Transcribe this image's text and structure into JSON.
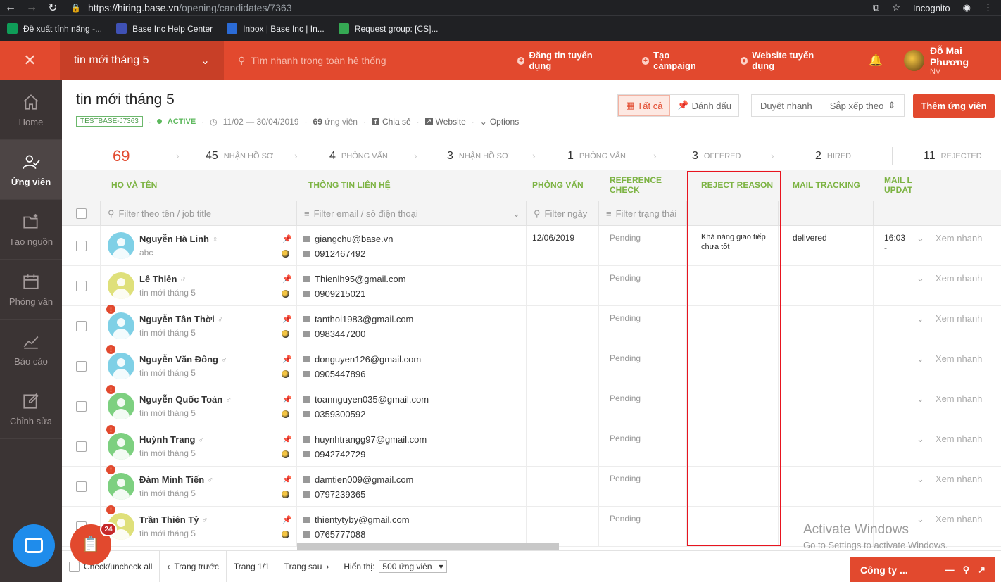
{
  "browser": {
    "url_base": "https://hiring.base.vn",
    "url_path": "/opening/candidates/7363",
    "incognito_label": "Incognito",
    "bookmarks": [
      {
        "label": "Đề xuất tính năng -...",
        "icon": "sheets-icon",
        "color": "#0f9d58"
      },
      {
        "label": "Base Inc Help Center",
        "icon": "shield-icon",
        "color": "#3f51b5"
      },
      {
        "label": "Inbox | Base Inc | In...",
        "icon": "intercom-icon",
        "color": "#2b6bd6"
      },
      {
        "label": "Request group: [CS]...",
        "icon": "circle-icon",
        "color": "#35a853"
      }
    ]
  },
  "header": {
    "opening_name": "tin mới tháng 5",
    "search_placeholder": "Tìm nhanh trong toàn hệ thống",
    "actions": [
      "Đăng tin tuyển dụng",
      "Tạo campaign",
      "Website tuyển dụng"
    ],
    "user_name": "Đỗ Mai Phương",
    "user_role": "NV",
    "accent_color": "#e2492e"
  },
  "sidebar": {
    "items": [
      {
        "label": "Home",
        "icon": "home-icon"
      },
      {
        "label": "Ứng viên",
        "icon": "candidates-icon",
        "active": true
      },
      {
        "label": "Tạo nguồn",
        "icon": "folder-add-icon"
      },
      {
        "label": "Phỏng vấn",
        "icon": "calendar-icon"
      },
      {
        "label": "Báo cáo",
        "icon": "chart-icon"
      },
      {
        "label": "Chỉnh sửa",
        "icon": "edit-icon"
      }
    ]
  },
  "page": {
    "title": "tin mới tháng 5",
    "code": "TESTBASE-J7363",
    "status": "ACTIVE",
    "date_range": "11/02 — 30/04/2019",
    "candidate_count": "69",
    "candidate_label": "ứng viên",
    "share": "Chia sẻ",
    "website": "Website",
    "options": "Options",
    "view_all": "Tất cả",
    "view_marked": "Đánh dấu",
    "quick_review": "Duyệt nhanh",
    "sort_by": "Sắp xếp theo",
    "add_candidate": "Thêm ứng viên"
  },
  "pipeline": [
    {
      "count": "69",
      "label": ""
    },
    {
      "count": "45",
      "label": "NHẬN HỒ SƠ"
    },
    {
      "count": "4",
      "label": "PHỎNG VẤN"
    },
    {
      "count": "3",
      "label": "NHẬN HỒ SƠ"
    },
    {
      "count": "1",
      "label": "PHỎNG VẤN"
    },
    {
      "count": "3",
      "label": "OFFERED"
    },
    {
      "count": "2",
      "label": "HIRED"
    },
    {
      "count": "11",
      "label": "REJECTED"
    }
  ],
  "table": {
    "headers": {
      "name": "HỌ VÀ TÊN",
      "contact": "THÔNG TIN LIÊN HỆ",
      "interview": "PHỎNG VẤN",
      "refcheck": "REFERENCE CHECK",
      "reject": "REJECT REASON",
      "mailtrack": "MAIL TRACKING",
      "mailupd": "MAIL L UPDAT"
    },
    "filters": {
      "name": "Filter theo tên / job title",
      "contact": "Filter email / số điện thoại",
      "date": "Filter ngày",
      "status": "Filter trạng thái"
    },
    "quick_view_label": "Xem nhanh",
    "rows": [
      {
        "name": "Nguyễn Hà Linh",
        "gender": "♀",
        "sub": "abc",
        "email": "giangchu@base.vn",
        "phone": "0912467492",
        "interview": "12/06/2019",
        "refcheck": "Pending",
        "reject": "Khả năng giao tiếp chưa tốt",
        "mailtrack": "delivered",
        "mailupd": "16:03 -",
        "avatar_color": "#7fd0e6",
        "alert": false
      },
      {
        "name": "Lê Thiên",
        "gender": "♂",
        "sub": "tin mới tháng 5",
        "email": "Thienlh95@gmail.com",
        "phone": "0909215021",
        "interview": "",
        "refcheck": "Pending",
        "reject": "",
        "mailtrack": "",
        "mailupd": "",
        "avatar_color": "#dfe07a",
        "alert": false
      },
      {
        "name": "Nguyễn Tân Thời",
        "gender": "♂",
        "sub": "tin mới tháng 5",
        "email": "tanthoi1983@gmail.com",
        "phone": "0983447200",
        "interview": "",
        "refcheck": "Pending",
        "reject": "",
        "mailtrack": "",
        "mailupd": "",
        "avatar_color": "#7fd0e6",
        "alert": true
      },
      {
        "name": "Nguyễn Văn Đông",
        "gender": "♂",
        "sub": "tin mới tháng 5",
        "email": "donguyen126@gmail.com",
        "phone": "0905447896",
        "interview": "",
        "refcheck": "Pending",
        "reject": "",
        "mailtrack": "",
        "mailupd": "",
        "avatar_color": "#7fd0e6",
        "alert": true
      },
      {
        "name": "Nguyễn Quốc Toản",
        "gender": "♂",
        "sub": "tin mới tháng 5",
        "email": "toannguyen035@gmail.com",
        "phone": "0359300592",
        "interview": "",
        "refcheck": "Pending",
        "reject": "",
        "mailtrack": "",
        "mailupd": "",
        "avatar_color": "#7dd080",
        "alert": true
      },
      {
        "name": "Huỳnh Trang",
        "gender": "♂",
        "sub": "tin mới tháng 5",
        "email": "huynhtrangg97@gmail.com",
        "phone": "0942742729",
        "interview": "",
        "refcheck": "Pending",
        "reject": "",
        "mailtrack": "",
        "mailupd": "",
        "avatar_color": "#7dd080",
        "alert": true
      },
      {
        "name": "Đàm Minh Tiến",
        "gender": "♂",
        "sub": "tin mới tháng 5",
        "email": "damtien009@gmail.com",
        "phone": "0797239365",
        "interview": "",
        "refcheck": "Pending",
        "reject": "",
        "mailtrack": "",
        "mailupd": "",
        "avatar_color": "#7dd080",
        "alert": true
      },
      {
        "name": "Trần Thiên Tỷ",
        "gender": "♂",
        "sub": "tin mới tháng 5",
        "email": "thientytyby@gmail.com",
        "phone": "0765777088",
        "interview": "",
        "refcheck": "Pending",
        "reject": "",
        "mailtrack": "",
        "mailupd": "",
        "avatar_color": "#dfe07a",
        "alert": true
      }
    ]
  },
  "footer": {
    "check_all": "Check/uncheck all",
    "prev": "Trang trước",
    "page": "Trang 1/1",
    "next": "Trang sau",
    "show_label": "Hiển thị:",
    "show_value": "500 ứng viên"
  },
  "widgets": {
    "task_count": "24",
    "company_tab": "Công ty ..."
  },
  "watermark": {
    "line1": "Activate Windows",
    "line2": "Go to Settings to activate Windows."
  }
}
